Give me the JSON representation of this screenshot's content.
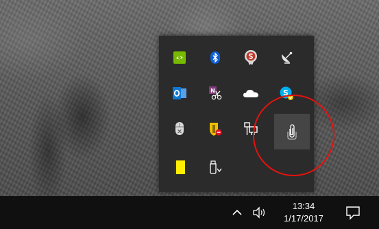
{
  "clock": {
    "time": "13:34",
    "date": "1/17/2017"
  },
  "colors": {
    "flyout_bg": "#2b2b2b",
    "taskbar_bg": "#101010",
    "highlight": "#454545",
    "annotation": "#e3130e",
    "nvidia_green": "#76b900",
    "bluetooth_blue": "#0a5fd7",
    "outlook_blue": "#0f78d4",
    "onenote_purple": "#80397b",
    "skype_blue": "#00aff0",
    "sticky_yellow": "#ffee00"
  },
  "tray": {
    "icons": [
      {
        "name": "nvidia-icon",
        "row": 1,
        "col": 1
      },
      {
        "name": "bluetooth-icon",
        "row": 1,
        "col": 2
      },
      {
        "name": "seal-s-icon",
        "row": 1,
        "col": 3
      },
      {
        "name": "satellite-dish-icon",
        "row": 1,
        "col": 4
      },
      {
        "name": "outlook-icon",
        "row": 2,
        "col": 1
      },
      {
        "name": "onenote-clip-icon",
        "row": 2,
        "col": 2
      },
      {
        "name": "onedrive-icon",
        "row": 2,
        "col": 3
      },
      {
        "name": "skype-icon",
        "row": 2,
        "col": 4
      },
      {
        "name": "mouse-icon",
        "row": 3,
        "col": 1
      },
      {
        "name": "security-shield-icon",
        "row": 3,
        "col": 2
      },
      {
        "name": "network-icon",
        "row": 3,
        "col": 3
      },
      {
        "name": "paperclip-icon",
        "row": 3,
        "col": 4,
        "highlighted": true
      },
      {
        "name": "sticky-note-icon",
        "row": 4,
        "col": 1
      },
      {
        "name": "usb-eject-icon",
        "row": 4,
        "col": 2
      }
    ]
  },
  "taskbar": {
    "icons": [
      "chevron-up-icon",
      "volume-icon",
      "notification-icon"
    ]
  }
}
